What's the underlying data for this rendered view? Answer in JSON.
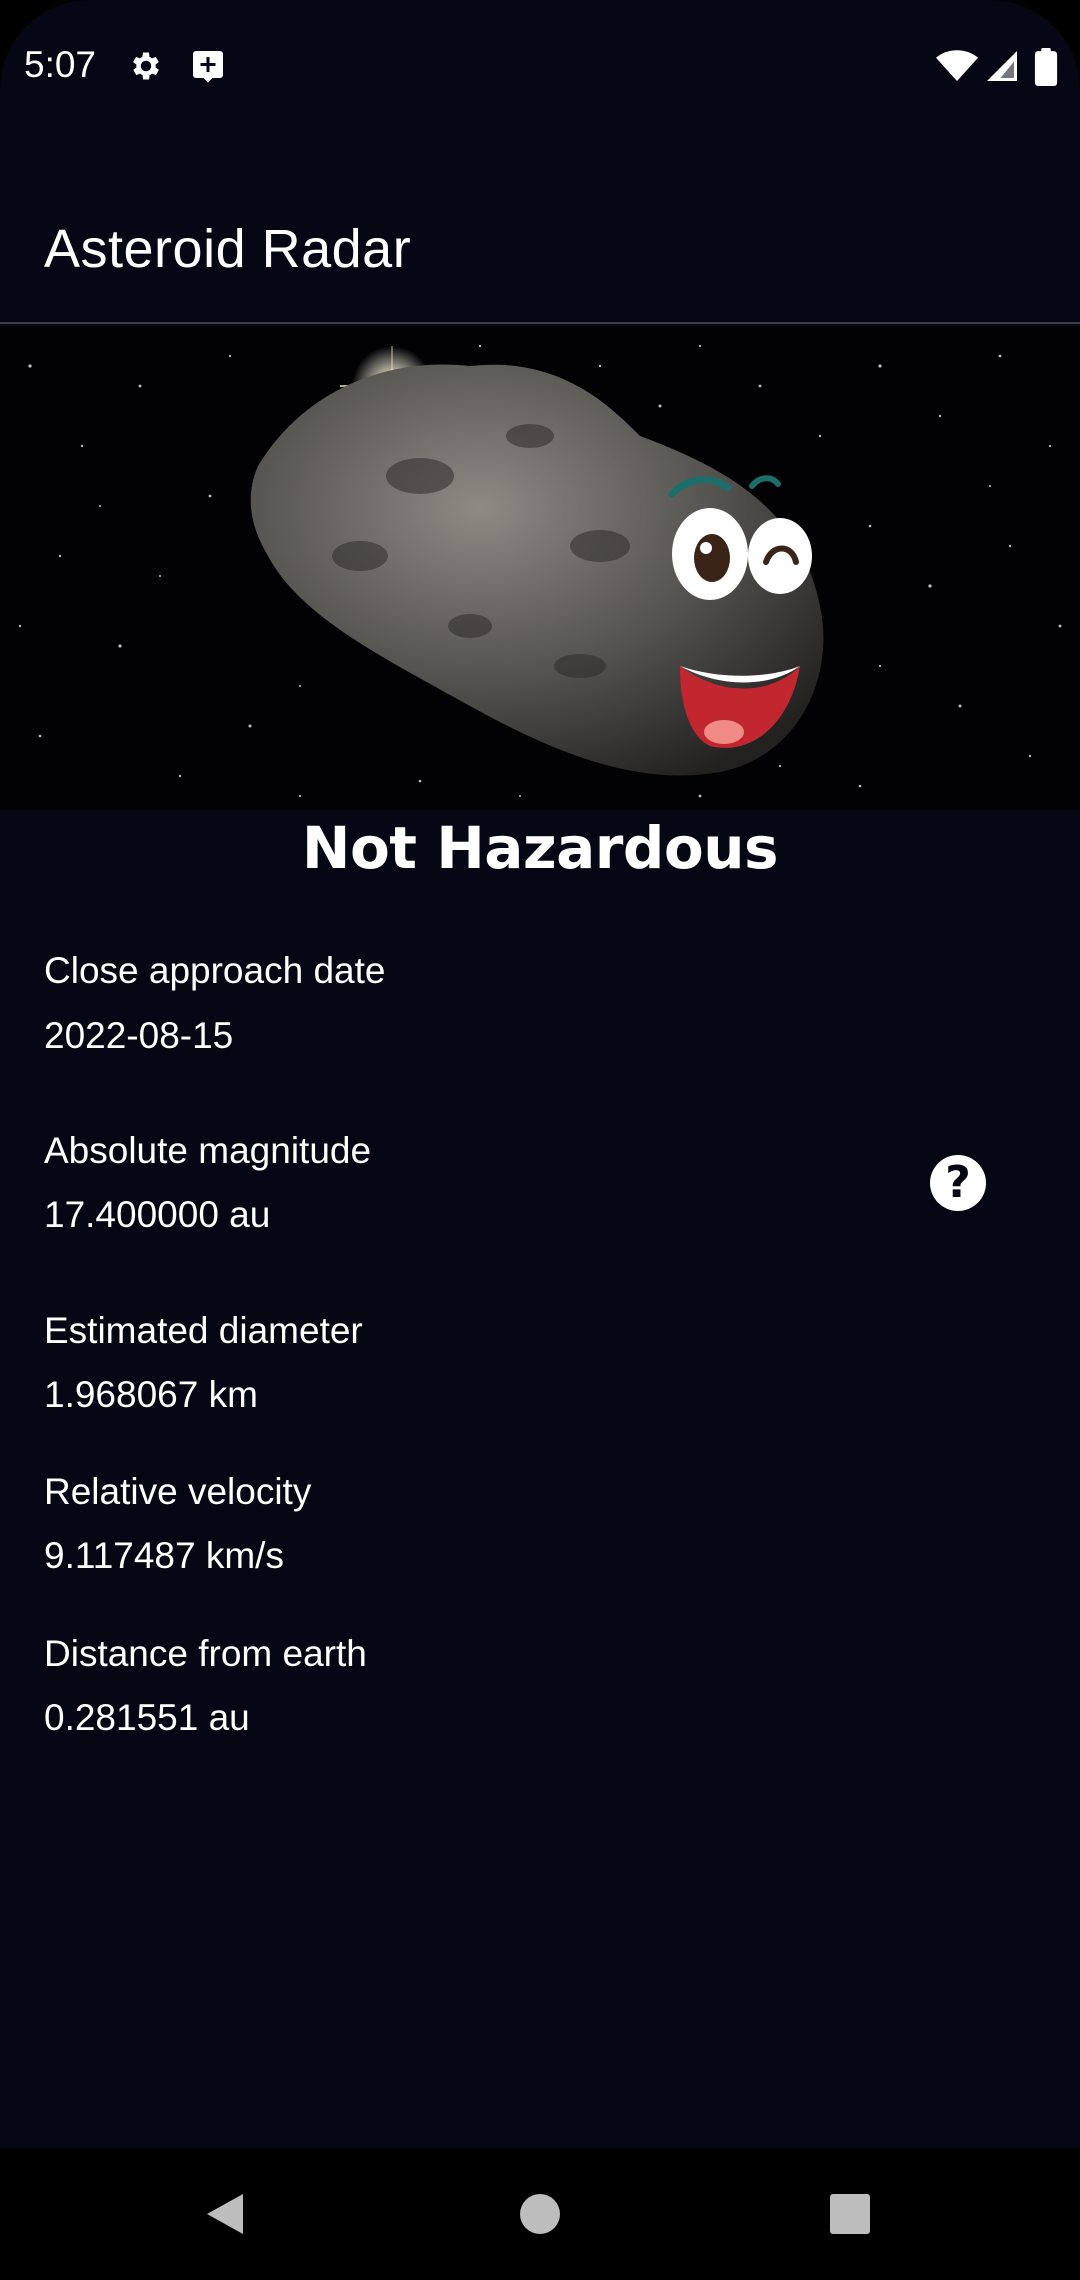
{
  "status_bar": {
    "time": "5:07",
    "icons": [
      "settings-gear-icon",
      "add-box-icon",
      "wifi-icon",
      "signal-icon",
      "battery-icon"
    ]
  },
  "app_bar": {
    "title": "Asteroid Radar"
  },
  "hero": {
    "image": "asteroid-happy-image"
  },
  "hazard": {
    "status": "Not Hazardous"
  },
  "details": {
    "close_approach_date": {
      "label": "Close approach date",
      "value": "2022-08-15"
    },
    "absolute_magnitude": {
      "label": "Absolute magnitude",
      "value": "17.400000 au"
    },
    "estimated_diameter": {
      "label": "Estimated diameter",
      "value": "1.968067 km"
    },
    "relative_velocity": {
      "label": "Relative velocity",
      "value": "9.117487 km/s"
    },
    "distance_from_earth": {
      "label": "Distance from earth",
      "value": "0.281551 au"
    }
  },
  "help": {
    "glyph": "?"
  },
  "nav_bar": {
    "buttons": [
      "back-icon",
      "home-icon",
      "recents-icon"
    ]
  },
  "colors": {
    "background": "#050814",
    "text": "#ffffff",
    "divider": "#3a3d47",
    "nav_bar": "#000000"
  }
}
